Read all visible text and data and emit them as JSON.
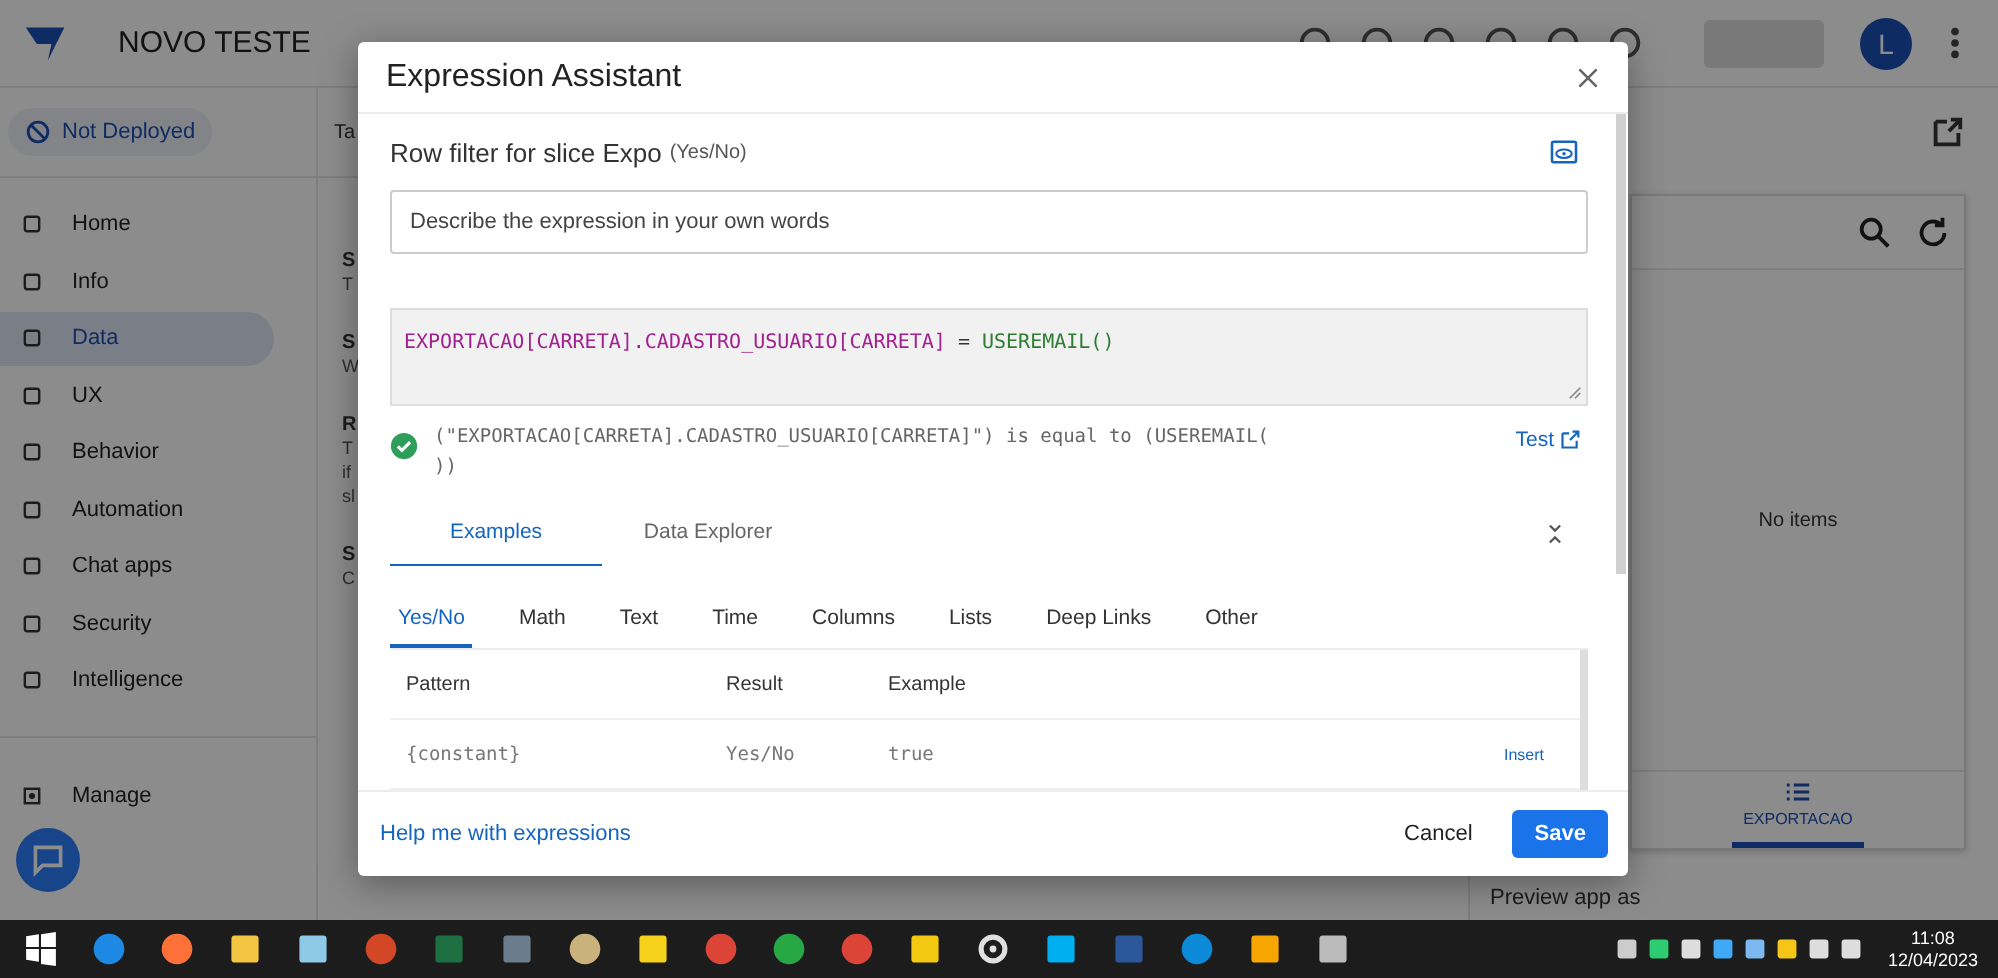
{
  "app": {
    "title": "NOVO TESTE",
    "deploy_status": "Not Deployed",
    "user_initial": "L"
  },
  "sidebar": {
    "items": [
      {
        "label": "Home",
        "selected": false
      },
      {
        "label": "Info",
        "selected": false
      },
      {
        "label": "Data",
        "selected": true
      },
      {
        "label": "UX",
        "selected": false
      },
      {
        "label": "Behavior",
        "selected": false
      },
      {
        "label": "Automation",
        "selected": false
      },
      {
        "label": "Chat apps",
        "selected": false
      },
      {
        "label": "Security",
        "selected": false
      },
      {
        "label": "Intelligence",
        "selected": false
      }
    ],
    "manage": "Manage"
  },
  "middle_panel": {
    "tab_fragment": "Ta",
    "sections": [
      {
        "title": "S",
        "lines": [
          "T"
        ]
      },
      {
        "title": "S",
        "lines": [
          "W"
        ]
      },
      {
        "title": "R",
        "lines": [
          "T",
          "if",
          "sl"
        ]
      },
      {
        "title": "S",
        "lines": [
          "C"
        ]
      }
    ]
  },
  "preview": {
    "empty_text": "No items",
    "nav_tab": {
      "label": "EXPORTACAO",
      "selected": true
    },
    "preview_as": "Preview app as"
  },
  "dialog": {
    "title": "Expression Assistant",
    "heading": "Row filter for slice Expo",
    "type_hint": "(Yes/No)",
    "description": {
      "placeholder": "Describe the expression in your own words"
    },
    "expression": [
      {
        "text": "EXPORTACAO[CARRETA].CADASTRO_USUARIO[CARRETA]",
        "kind": "column"
      },
      {
        "text": " = ",
        "kind": "operator"
      },
      {
        "text": "USEREMAIL()",
        "kind": "function"
      }
    ],
    "valid": true,
    "explanation": "(\"EXPORTACAO[CARRETA].CADASTRO_USUARIO[CARRETA]\") is equal to (USEREMAIL(\n))",
    "test_link": "Test",
    "tabs": [
      {
        "label": "Examples",
        "selected": true
      },
      {
        "label": "Data Explorer",
        "selected": false
      }
    ],
    "categories": [
      {
        "label": "Yes/No",
        "selected": true
      },
      {
        "label": "Math",
        "selected": false
      },
      {
        "label": "Text",
        "selected": false
      },
      {
        "label": "Time",
        "selected": false
      },
      {
        "label": "Columns",
        "selected": false
      },
      {
        "label": "Lists",
        "selected": false
      },
      {
        "label": "Deep Links",
        "selected": false
      },
      {
        "label": "Other",
        "selected": false
      }
    ],
    "table": {
      "columns": [
        "Pattern",
        "Result",
        "Example"
      ],
      "rows": [
        {
          "pattern": "{constant}",
          "result": "Yes/No",
          "example": "true",
          "action": "Insert"
        }
      ]
    },
    "help_link": "Help me with expressions",
    "cancel": "Cancel",
    "save": "Save"
  },
  "taskbar": {
    "time": "11:08",
    "date": "12/04/2023"
  }
}
